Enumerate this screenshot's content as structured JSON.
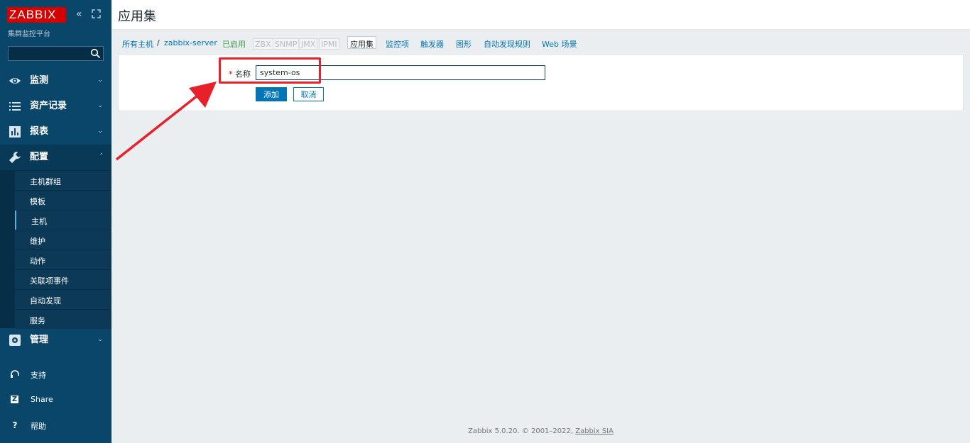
{
  "app": {
    "logo_text": "ZABBIX",
    "subtitle": "集群监控平台",
    "brand_color": "#d40000",
    "sidebar_color": "#0a466a"
  },
  "search": {
    "placeholder": "",
    "value": ""
  },
  "menu": [
    {
      "label": "监测",
      "icon": "eye-icon"
    },
    {
      "label": "资产记录",
      "icon": "list-icon"
    },
    {
      "label": "报表",
      "icon": "bar-chart-icon"
    },
    {
      "label": "配置",
      "icon": "wrench-icon"
    },
    {
      "label": "管理",
      "icon": "gear-icon"
    }
  ],
  "submenu": [
    {
      "label": "主机群组"
    },
    {
      "label": "模板"
    },
    {
      "label": "主机"
    },
    {
      "label": "维护"
    },
    {
      "label": "动作"
    },
    {
      "label": "关联项事件"
    },
    {
      "label": "自动发现"
    },
    {
      "label": "服务"
    }
  ],
  "bottom": [
    {
      "label": "支持",
      "icon": "headset-icon"
    },
    {
      "label": "Share",
      "icon": "zabbix-share-icon"
    },
    {
      "label": "帮助",
      "icon": "help-icon"
    }
  ],
  "page": {
    "title": "应用集"
  },
  "breadcrumb": {
    "all_hosts": "所有主机",
    "separator": "/",
    "host": "zabbix-server",
    "status": "已启用",
    "protocols": [
      "ZBX",
      "SNMP",
      "JMX",
      "IPMI"
    ],
    "tabs": [
      "应用集",
      "监控项",
      "触发器",
      "图形",
      "自动发现规则",
      "Web 场景"
    ]
  },
  "form": {
    "required_mark": "*",
    "name_label": "名称",
    "name_value": "system-os",
    "add_label": "添加",
    "cancel_label": "取消"
  },
  "footer": {
    "text": "Zabbix 5.0.20. © 2001–2022,",
    "link": "Zabbix SIA"
  }
}
